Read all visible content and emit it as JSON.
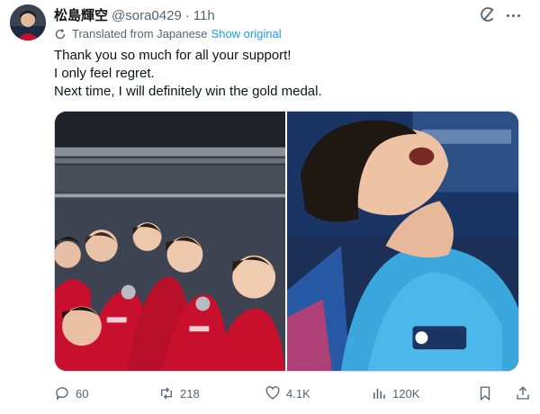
{
  "tweet": {
    "display_name": "松島輝空",
    "handle": "@sora0429",
    "separator": "·",
    "time": "11h",
    "translated_label": "Translated from Japanese",
    "show_original_label": "Show original",
    "text_lines": [
      "Thank you so much for all your support!",
      "I only feel regret.",
      "Next time, I will definitely win the gold medal."
    ]
  },
  "actions": {
    "replies": "60",
    "reposts": "218",
    "likes": "4.1K",
    "views": "120K"
  },
  "icons": {
    "grok": "grok-icon",
    "more": "more-icon",
    "translate": "translate-icon",
    "reply": "reply-icon",
    "repost": "repost-icon",
    "like": "heart-icon",
    "views": "views-icon",
    "bookmark": "bookmark-icon",
    "share": "share-icon"
  },
  "colors": {
    "text": "#0f1419",
    "secondary": "#536471",
    "link": "#1d9bf0",
    "border": "#cfd9de"
  }
}
